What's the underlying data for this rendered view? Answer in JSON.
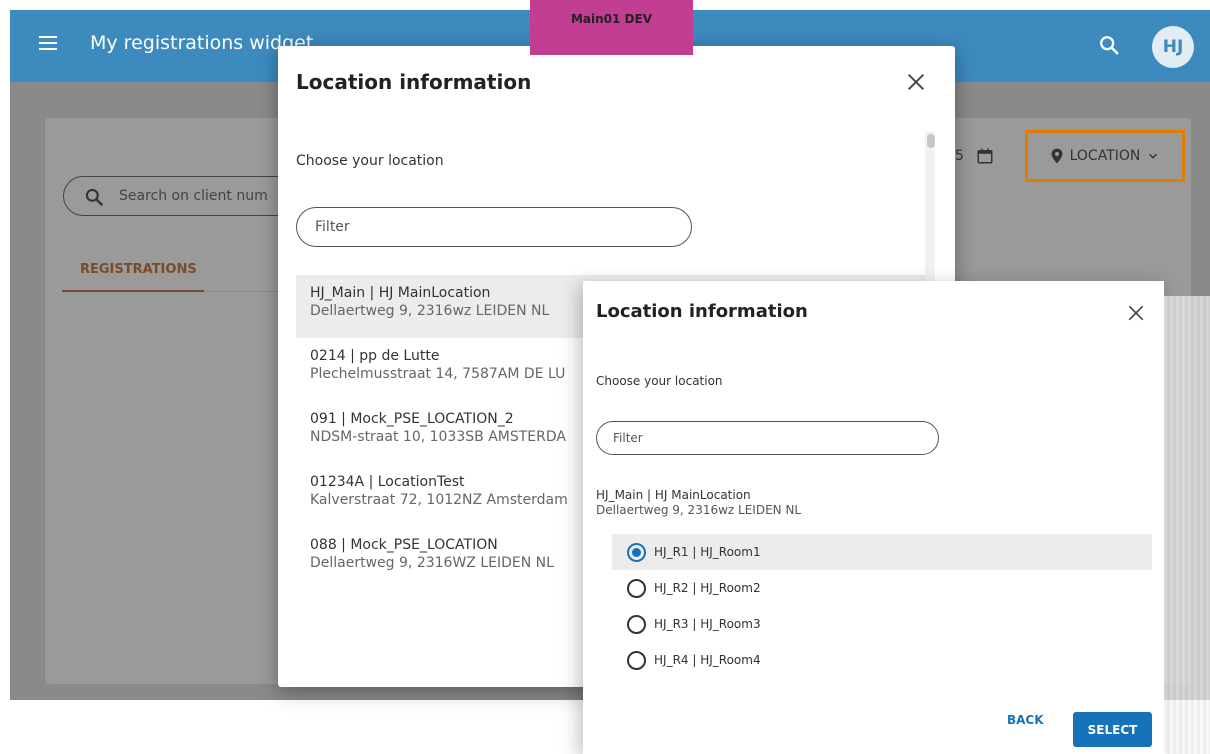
{
  "app": {
    "title": "My registrations widget",
    "env_badge": "Main01 DEV",
    "avatar_initials": "HJ"
  },
  "background": {
    "search_placeholder": "Search on client num",
    "tab_label": "REGISTRATIONS",
    "date_suffix": "5",
    "location_button": "LOCATION"
  },
  "dialog1": {
    "title": "Location information",
    "choose_label": "Choose your location",
    "filter_placeholder": "Filter",
    "items": [
      {
        "line1": "HJ_Main | HJ MainLocation",
        "line2": "Dellaertweg 9, 2316wz LEIDEN NL"
      },
      {
        "line1": "0214 | pp de Lutte",
        "line2": "Plechelmusstraat 14, 7587AM DE LU"
      },
      {
        "line1": "091 | Mock_PSE_LOCATION_2",
        "line2": "NDSM-straat 10, 1033SB AMSTERDA"
      },
      {
        "line1": "01234A | LocationTest",
        "line2": "Kalverstraat 72, 1012NZ Amsterdam"
      },
      {
        "line1": "088 | Mock_PSE_LOCATION",
        "line2": "Dellaertweg 9, 2316WZ LEIDEN NL"
      }
    ]
  },
  "dialog2": {
    "title": "Location information",
    "choose_label": "Choose your location",
    "filter_placeholder": "Filter",
    "location": {
      "line1": "HJ_Main | HJ MainLocation",
      "line2": "Dellaertweg 9, 2316wz LEIDEN NL"
    },
    "rooms": [
      {
        "label": "HJ_R1 | HJ_Room1",
        "checked": true
      },
      {
        "label": "HJ_R2 | HJ_Room2",
        "checked": false
      },
      {
        "label": "HJ_R3 | HJ_Room3",
        "checked": false
      },
      {
        "label": "HJ_R4 | HJ_Room4",
        "checked": false
      }
    ],
    "back_label": "BACK",
    "select_label": "SELECT"
  },
  "colors": {
    "appbar": "#3d8bbe",
    "env_badge": "#c13e93",
    "primary": "#1673b9",
    "highlight_border": "#e07c00"
  }
}
